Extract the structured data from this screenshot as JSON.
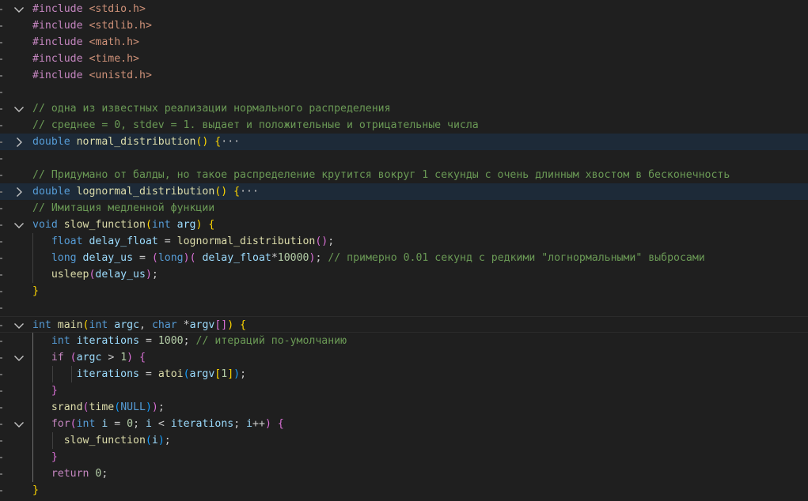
{
  "editor": {
    "lines": [
      {
        "fold": "expanded",
        "tokens": [
          [
            "pp",
            "#include"
          ],
          [
            "punc",
            " "
          ],
          [
            "inc",
            "<stdio.h>"
          ]
        ]
      },
      {
        "fold": "",
        "tokens": [
          [
            "pp",
            "#include"
          ],
          [
            "punc",
            " "
          ],
          [
            "inc",
            "<stdlib.h>"
          ]
        ]
      },
      {
        "fold": "",
        "tokens": [
          [
            "pp",
            "#include"
          ],
          [
            "punc",
            " "
          ],
          [
            "inc",
            "<math.h>"
          ]
        ]
      },
      {
        "fold": "",
        "tokens": [
          [
            "pp",
            "#include"
          ],
          [
            "punc",
            " "
          ],
          [
            "inc",
            "<time.h>"
          ]
        ]
      },
      {
        "fold": "",
        "tokens": [
          [
            "pp",
            "#include"
          ],
          [
            "punc",
            " "
          ],
          [
            "inc",
            "<unistd.h>"
          ]
        ]
      },
      {
        "fold": "",
        "tokens": []
      },
      {
        "fold": "expanded",
        "tokens": [
          [
            "cmt",
            "// одна из известных реализации нормального распределения"
          ]
        ]
      },
      {
        "fold": "",
        "tokens": [
          [
            "cmt",
            "// среднее = 0, stdev = 1. выдает и положительные и отрицательные числа"
          ]
        ]
      },
      {
        "fold": "collapsed",
        "highlight": true,
        "tokens": [
          [
            "kw",
            "double"
          ],
          [
            "punc",
            " "
          ],
          [
            "fn",
            "normal_distribution"
          ],
          [
            "b1",
            "()"
          ],
          [
            "punc",
            " "
          ],
          [
            "b1",
            "{"
          ],
          [
            "ell",
            "···"
          ]
        ]
      },
      {
        "fold": "",
        "tokens": []
      },
      {
        "fold": "",
        "tokens": [
          [
            "cmt",
            "// Придумано от балды, но такое распределение крутится вокруг 1 секунды с очень длинным хвостом в бесконечность"
          ]
        ]
      },
      {
        "fold": "collapsed",
        "highlight": true,
        "tokens": [
          [
            "kw",
            "double"
          ],
          [
            "punc",
            " "
          ],
          [
            "fn",
            "lognormal_distribution"
          ],
          [
            "b1",
            "()"
          ],
          [
            "punc",
            " "
          ],
          [
            "b1",
            "{"
          ],
          [
            "ell",
            "···"
          ]
        ]
      },
      {
        "fold": "",
        "tokens": [
          [
            "cmt",
            "// Имитация медленной функции"
          ]
        ]
      },
      {
        "fold": "expanded",
        "tokens": [
          [
            "kw",
            "void"
          ],
          [
            "punc",
            " "
          ],
          [
            "fn",
            "slow_function"
          ],
          [
            "b1",
            "("
          ],
          [
            "kw",
            "int"
          ],
          [
            "punc",
            " "
          ],
          [
            "var",
            "arg"
          ],
          [
            "b1",
            ")"
          ],
          [
            "punc",
            " "
          ],
          [
            "b1",
            "{"
          ]
        ]
      },
      {
        "fold": "",
        "tokens": [
          [
            "punc",
            "   "
          ],
          [
            "kw",
            "float"
          ],
          [
            "punc",
            " "
          ],
          [
            "var",
            "delay_float"
          ],
          [
            "punc",
            " = "
          ],
          [
            "fn",
            "lognormal_distribution"
          ],
          [
            "b2",
            "()"
          ],
          [
            "punc",
            ";"
          ]
        ]
      },
      {
        "fold": "",
        "tokens": [
          [
            "punc",
            "   "
          ],
          [
            "kw",
            "long"
          ],
          [
            "punc",
            " "
          ],
          [
            "var",
            "delay_us"
          ],
          [
            "punc",
            " = "
          ],
          [
            "b2",
            "("
          ],
          [
            "kw",
            "long"
          ],
          [
            "b2",
            ")"
          ],
          [
            "b2",
            "("
          ],
          [
            "punc",
            " "
          ],
          [
            "var",
            "delay_float"
          ],
          [
            "punc",
            "*"
          ],
          [
            "num",
            "10000"
          ],
          [
            "b2",
            ")"
          ],
          [
            "punc",
            "; "
          ],
          [
            "cmt",
            "// примерно 0.01 секунд с редкими \"логнормальными\" выбросами"
          ]
        ]
      },
      {
        "fold": "",
        "tokens": [
          [
            "punc",
            "   "
          ],
          [
            "fn",
            "usleep"
          ],
          [
            "b2",
            "("
          ],
          [
            "var",
            "delay_us"
          ],
          [
            "b2",
            ")"
          ],
          [
            "punc",
            ";"
          ]
        ]
      },
      {
        "fold": "",
        "tokens": [
          [
            "b1",
            "}"
          ]
        ]
      },
      {
        "fold": "",
        "tokens": []
      },
      {
        "fold": "expanded",
        "current": true,
        "tokens": [
          [
            "kw",
            "int"
          ],
          [
            "punc",
            " "
          ],
          [
            "fn",
            "main"
          ],
          [
            "b1",
            "("
          ],
          [
            "kw",
            "int"
          ],
          [
            "punc",
            " "
          ],
          [
            "var",
            "argc"
          ],
          [
            "punc",
            ", "
          ],
          [
            "kw",
            "char"
          ],
          [
            "punc",
            " *"
          ],
          [
            "var",
            "argv"
          ],
          [
            "b2",
            "[]"
          ],
          [
            "b1",
            ")"
          ],
          [
            "punc",
            " "
          ],
          [
            "b1",
            "{"
          ]
        ]
      },
      {
        "fold": "",
        "tokens": [
          [
            "punc",
            "   "
          ],
          [
            "kw",
            "int"
          ],
          [
            "punc",
            " "
          ],
          [
            "var",
            "iterations"
          ],
          [
            "punc",
            " = "
          ],
          [
            "num",
            "1000"
          ],
          [
            "punc",
            "; "
          ],
          [
            "cmt",
            "// итераций по-умолчанию"
          ]
        ]
      },
      {
        "fold": "expanded",
        "tokens": [
          [
            "punc",
            "   "
          ],
          [
            "ctl",
            "if"
          ],
          [
            "punc",
            " "
          ],
          [
            "b2",
            "("
          ],
          [
            "var",
            "argc"
          ],
          [
            "punc",
            " > "
          ],
          [
            "num",
            "1"
          ],
          [
            "b2",
            ")"
          ],
          [
            "punc",
            " "
          ],
          [
            "b2",
            "{"
          ]
        ]
      },
      {
        "fold": "",
        "tokens": [
          [
            "punc",
            "       "
          ],
          [
            "var",
            "iterations"
          ],
          [
            "punc",
            " = "
          ],
          [
            "fn",
            "atoi"
          ],
          [
            "b3",
            "("
          ],
          [
            "var",
            "argv"
          ],
          [
            "b1",
            "["
          ],
          [
            "num",
            "1"
          ],
          [
            "b1",
            "]"
          ],
          [
            "b3",
            ")"
          ],
          [
            "punc",
            ";"
          ]
        ]
      },
      {
        "fold": "",
        "tokens": [
          [
            "punc",
            "   "
          ],
          [
            "b2",
            "}"
          ]
        ]
      },
      {
        "fold": "",
        "tokens": [
          [
            "punc",
            "   "
          ],
          [
            "fn",
            "srand"
          ],
          [
            "b2",
            "("
          ],
          [
            "fn",
            "time"
          ],
          [
            "b3",
            "("
          ],
          [
            "kw",
            "NULL"
          ],
          [
            "b3",
            ")"
          ],
          [
            "b2",
            ")"
          ],
          [
            "punc",
            ";"
          ]
        ]
      },
      {
        "fold": "expanded",
        "tokens": [
          [
            "punc",
            "   "
          ],
          [
            "ctl",
            "for"
          ],
          [
            "b2",
            "("
          ],
          [
            "kw",
            "int"
          ],
          [
            "punc",
            " "
          ],
          [
            "var",
            "i"
          ],
          [
            "punc",
            " = "
          ],
          [
            "num",
            "0"
          ],
          [
            "punc",
            "; "
          ],
          [
            "var",
            "i"
          ],
          [
            "punc",
            " < "
          ],
          [
            "var",
            "iterations"
          ],
          [
            "punc",
            "; "
          ],
          [
            "var",
            "i"
          ],
          [
            "punc",
            "++"
          ],
          [
            "b2",
            ")"
          ],
          [
            "punc",
            " "
          ],
          [
            "b2",
            "{"
          ]
        ]
      },
      {
        "fold": "",
        "tokens": [
          [
            "punc",
            "     "
          ],
          [
            "fn",
            "slow_function"
          ],
          [
            "b3",
            "("
          ],
          [
            "var",
            "i"
          ],
          [
            "b3",
            ")"
          ],
          [
            "punc",
            ";"
          ]
        ]
      },
      {
        "fold": "",
        "tokens": [
          [
            "punc",
            "   "
          ],
          [
            "b2",
            "}"
          ]
        ]
      },
      {
        "fold": "",
        "tokens": [
          [
            "punc",
            "   "
          ],
          [
            "ctl",
            "return"
          ],
          [
            "punc",
            " "
          ],
          [
            "num",
            "0"
          ],
          [
            "punc",
            ";"
          ]
        ]
      },
      {
        "fold": "",
        "tokens": [
          [
            "b1",
            "}"
          ]
        ]
      }
    ]
  }
}
